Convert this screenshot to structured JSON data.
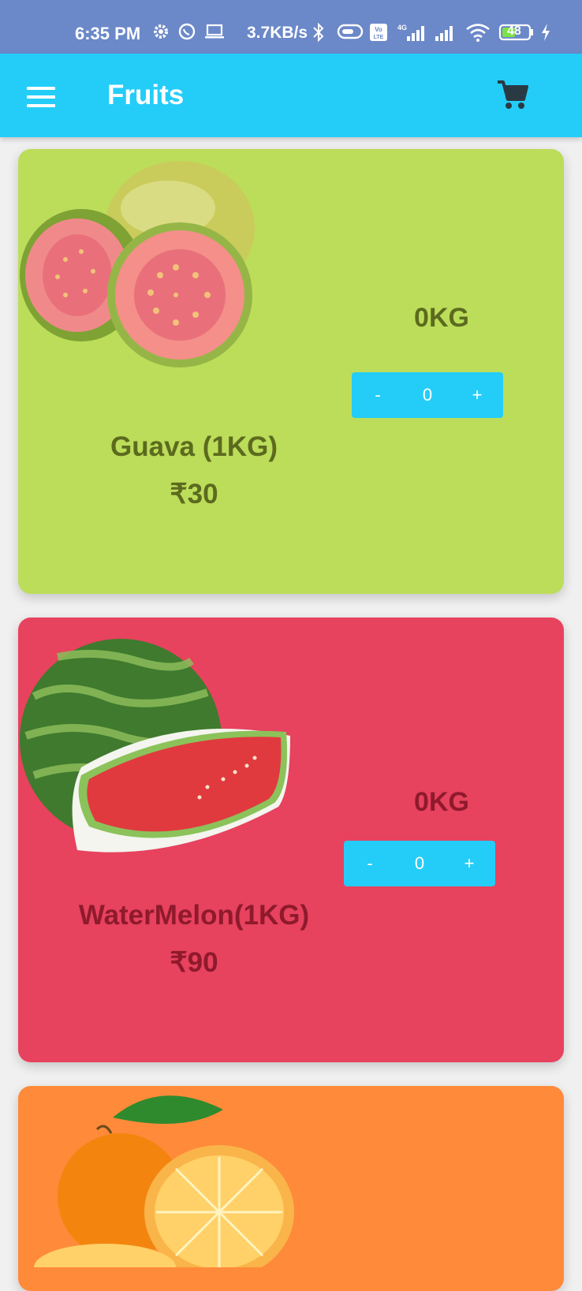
{
  "status_bar": {
    "time": "6:35 PM",
    "net_speed": "3.7KB/s",
    "battery": "48",
    "icons": [
      "gear-icon",
      "whatsapp-icon",
      "laptop-icon",
      "bluetooth-icon",
      "toggle-icon",
      "volte-icon",
      "signal-4g-icon",
      "signal-icon",
      "wifi-icon",
      "battery-icon",
      "charging-icon"
    ]
  },
  "appbar": {
    "title": "Fruits",
    "icons": {
      "menu": "menu-icon",
      "cart": "cart-icon"
    }
  },
  "products": [
    {
      "name": "Guava (1KG)",
      "price": "₹30",
      "weight": "0KG",
      "quantity": "0",
      "minus": "-",
      "plus": "+",
      "color": "#bcdd5a",
      "text_color": "#5c6a1e"
    },
    {
      "name": "WaterMelon(1KG)",
      "price": "₹90",
      "weight": "0KG",
      "quantity": "0",
      "minus": "-",
      "plus": "+",
      "color": "#e7425e",
      "text_color": "#8e1a2c"
    },
    {
      "color": "#ff8a3a"
    }
  ],
  "colors": {
    "accent": "#24cdf8",
    "status_bar": "#6b88c9"
  }
}
